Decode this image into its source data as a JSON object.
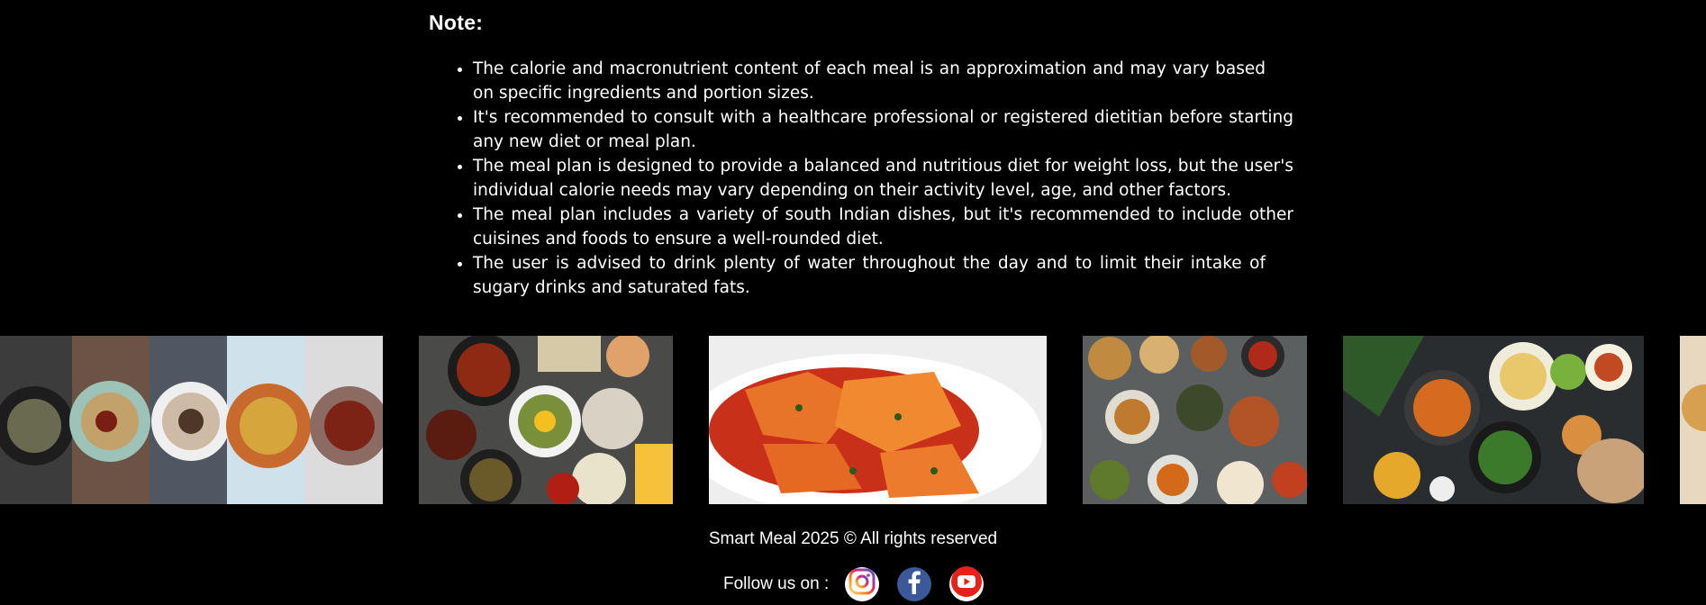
{
  "note": {
    "title": "Note:",
    "items": [
      "The calorie and macronutrient content of each meal is an approximation and may vary based on specific ingredients and portion sizes.",
      "It's recommended to consult with a healthcare professional or registered dietitian before starting any new diet or meal plan.",
      "The meal plan is designed to provide a balanced and nutritious diet for weight loss, but the user's individual calorie needs may vary depending on their activity level, age, and other factors.",
      "The meal plan includes a variety of south Indian dishes, but it's recommended to include other cuisines and foods to ensure a well-rounded diet.",
      "The user is advised to drink plenty of water throughout the day and to limit their intake of sugary drinks and saturated fats."
    ]
  },
  "gallery": {
    "images": [
      {
        "name": "food-image-assorted-bowls"
      },
      {
        "name": "food-image-korean-spread"
      },
      {
        "name": "food-image-ravioli"
      },
      {
        "name": "food-image-asian-spread"
      },
      {
        "name": "food-image-indian-spread"
      },
      {
        "name": "food-image-partial"
      }
    ]
  },
  "footer": {
    "copyright": "Smart Meal 2025 © All rights reserved",
    "follow_label": "Follow us on :",
    "social": [
      {
        "icon": "instagram-icon",
        "color": "#c13584"
      },
      {
        "icon": "facebook-icon",
        "color": "#3b5998"
      },
      {
        "icon": "youtube-icon",
        "color": "#e62117"
      }
    ]
  }
}
